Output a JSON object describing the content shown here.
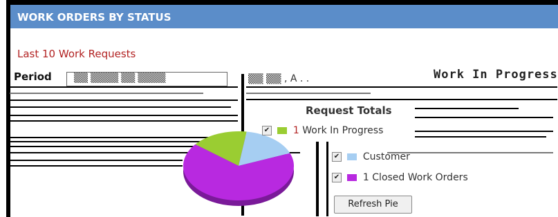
{
  "panel": {
    "title": "WORK ORDERS BY STATUS"
  },
  "links": {
    "recent_requests": "Last 10 Work Requests"
  },
  "filters": {
    "period_label": "Period",
    "status_selected": "Work In Progress"
  },
  "legend": {
    "title": "Request Totals",
    "items": [
      {
        "count": "1",
        "label": "Work In Progress",
        "checked": true,
        "color": "#9acd32"
      },
      {
        "count": "",
        "label": "Customer",
        "checked": true,
        "color": "#a6cef2"
      },
      {
        "count": "1",
        "label": "Closed Work Orders",
        "checked": true,
        "color": "#b829e0"
      }
    ]
  },
  "buttons": {
    "refresh": "Refresh Pie"
  },
  "chart_data": {
    "type": "pie",
    "slices": [
      {
        "label": "Work In Progress",
        "value": 1,
        "color": "#9acd32"
      },
      {
        "label": "Customer",
        "value": 1,
        "color": "#a6cef2"
      },
      {
        "label": "Closed Work Orders",
        "value": 4,
        "color": "#b829e0"
      }
    ]
  },
  "colors": {
    "header_bg": "#5b8dc9",
    "link": "#b22222"
  }
}
